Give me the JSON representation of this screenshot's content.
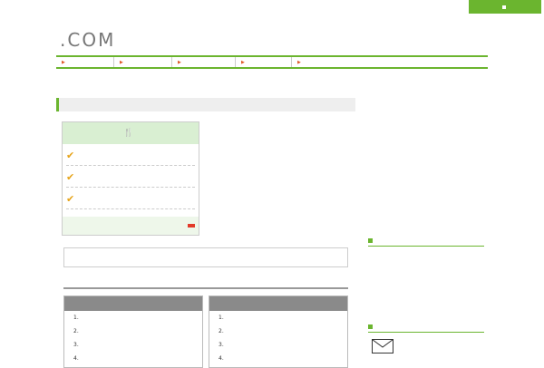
{
  "topbar": {
    "button_label": ""
  },
  "header": {
    "logo_kanji": "",
    "logo_suffix": ".COM",
    "tagline": ""
  },
  "nav": {
    "items": [
      "",
      "",
      "",
      "",
      ""
    ]
  },
  "breadcrumb": "",
  "main": {
    "heading": "",
    "banner": {
      "head": "",
      "rows": [
        {
          "pre": "",
          "accent": "",
          "post": ""
        },
        {
          "pre": "",
          "accent": "",
          "post": ""
        },
        {
          "pre": "",
          "accent": "",
          "post": ""
        }
      ],
      "logo_text": "",
      "logo_sub": "",
      "detail_button": ""
    },
    "intro_p1": "",
    "intro_p2": "",
    "box_heading": "",
    "sub_heading": "",
    "list_left": {
      "heading": "",
      "items": [
        "",
        "",
        "",
        ""
      ]
    },
    "list_right": {
      "heading": "",
      "items": [
        "",
        "",
        "",
        ""
      ]
    }
  },
  "sidebar": {
    "section1_heading": "",
    "p1": "",
    "p2_pre": "",
    "p2_link": "",
    "p2_post": "",
    "p3_pre": "",
    "p3_link": "",
    "p3_post": "",
    "section2_heading": "",
    "mail_link": ""
  },
  "colors": {
    "brand_green": "#6bb52f",
    "link_blue": "#1a3bd1",
    "accent_red": "#e23a2a"
  }
}
